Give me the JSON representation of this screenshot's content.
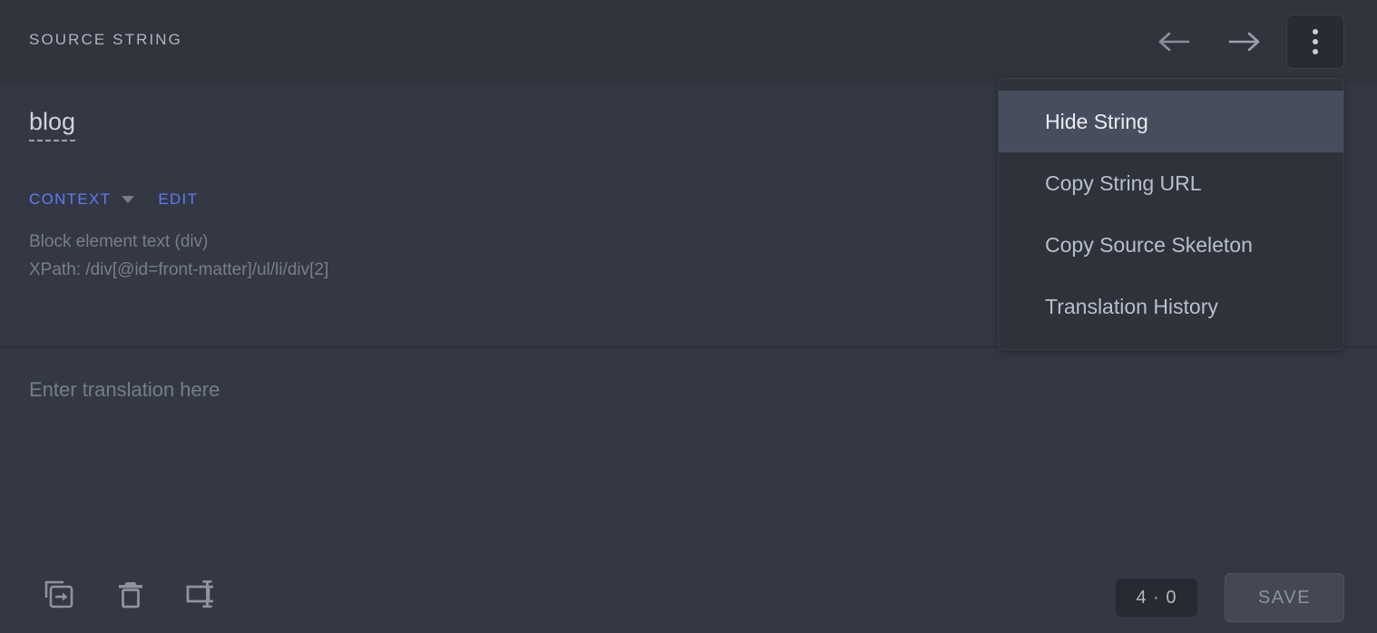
{
  "header": {
    "title": "SOURCE STRING",
    "prev_icon": "arrow-left-icon",
    "next_icon": "arrow-right-icon",
    "menu_icon": "kebab-menu-icon"
  },
  "source": {
    "text": "blog",
    "context_label": "CONTEXT",
    "context_caret": "chevron-down-icon",
    "edit_label": "EDIT",
    "context_lines": [
      "Block element text (div)",
      "XPath: /div[@id=front-matter]/ul/li/div[2]"
    ]
  },
  "translation": {
    "value": "",
    "placeholder": "Enter translation here"
  },
  "toolbar": {
    "copy_source_icon": "copy-source-to-translation-icon",
    "delete_icon": "trash-icon",
    "split_icon": "split-segment-icon",
    "count_badge": "4 · 0",
    "save_label": "SAVE"
  },
  "dropdown": {
    "items": [
      {
        "label": "Hide String",
        "highlighted": true
      },
      {
        "label": "Copy String URL",
        "highlighted": false
      },
      {
        "label": "Copy Source Skeleton",
        "highlighted": false
      },
      {
        "label": "Translation History",
        "highlighted": false
      }
    ]
  },
  "colors": {
    "background": "#343843",
    "header_background": "#30343d",
    "menu_background": "#2e323b",
    "menu_highlight": "#474d5c",
    "accent_link": "#5c7cfa",
    "muted_text": "#787e8a",
    "primary_text": "#cfd4dc"
  }
}
